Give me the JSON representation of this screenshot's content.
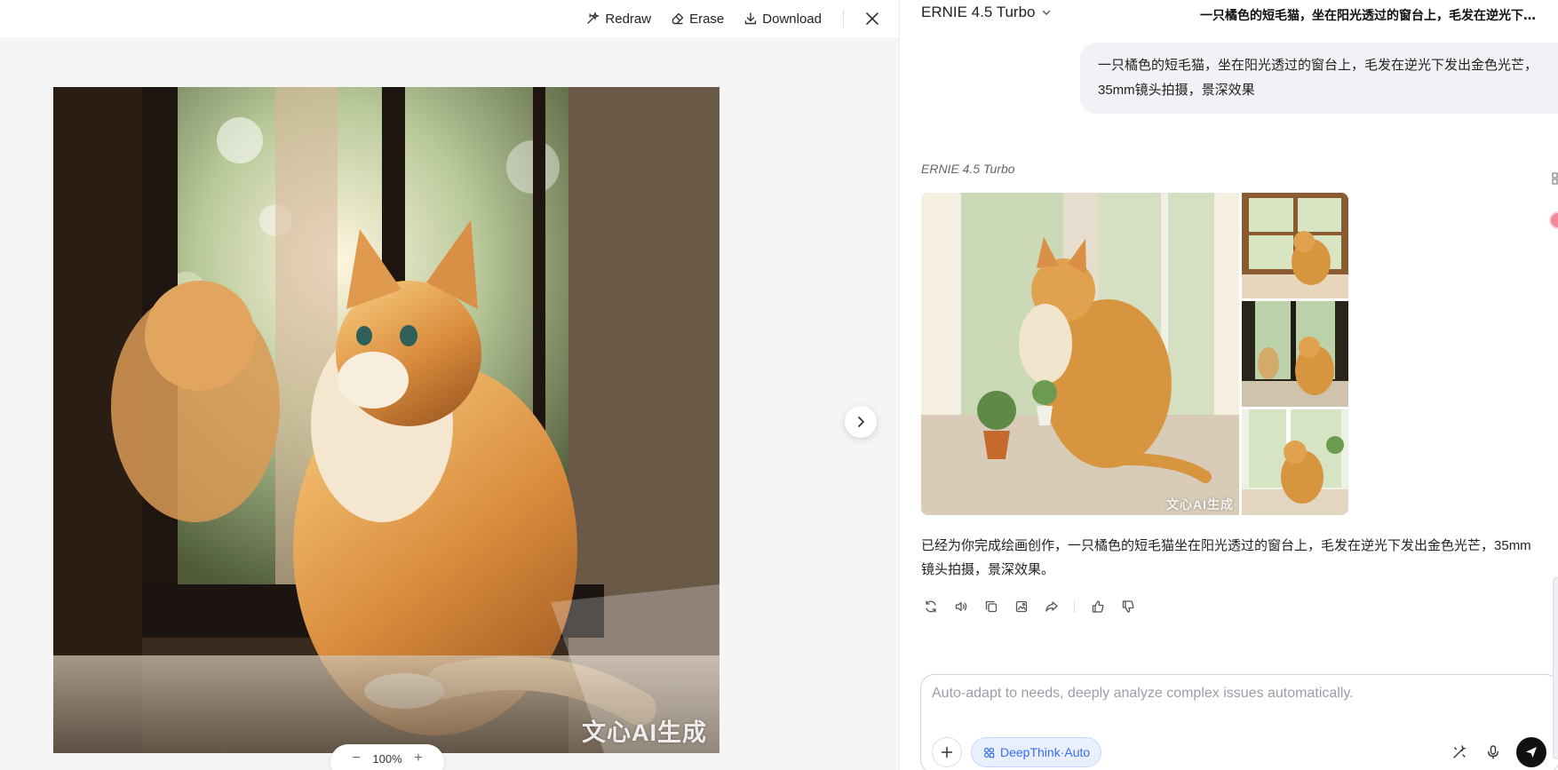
{
  "preview": {
    "toolbar": {
      "redraw_label": "Redraw",
      "erase_label": "Erase",
      "download_label": "Download"
    },
    "watermark": "文心AI生成",
    "zoom": {
      "value": "100%",
      "minus": "−",
      "plus": "+"
    }
  },
  "chat": {
    "model_name": "ERNIE 4.5 Turbo",
    "title": "一只橘色的短毛猫，坐在阳光透过的窗台上，毛发在逆光下发...",
    "user_message": "一只橘色的短毛猫，坐在阳光透过的窗台上，毛发在逆光下发出金色光芒，35mm镜头拍摄，景深效果",
    "response_model": "ERNIE 4.5 Turbo",
    "image_watermark": "文心AI生成",
    "response_text": "已经为你完成绘画创作，一只橘色的短毛猫坐在阳光透过的窗台上，毛发在逆光下发出金色光芒，35mm镜头拍摄，景深效果。"
  },
  "composer": {
    "placeholder": "Auto-adapt to needs, deeply analyze complex issues automatically.",
    "deepthink_label": "DeepThink·Auto"
  },
  "icons": {
    "redraw": "redraw-icon",
    "erase": "eraser-icon",
    "download": "download-icon",
    "close": "close-icon",
    "next": "chevron-right-icon",
    "regenerate": "refresh-icon",
    "speaker": "speaker-icon",
    "copy": "copy-icon",
    "image": "image-icon",
    "share": "share-icon",
    "like": "thumbs-up-icon",
    "dislike": "thumbs-down-icon",
    "plus": "plus-icon",
    "deepthink": "deepthink-icon",
    "tools": "magic-wand-icon",
    "mic": "microphone-icon",
    "send": "send-icon"
  },
  "colors": {
    "accent": "#3b6cf0",
    "bubble": "#f1f2f5",
    "send_button": "#111111"
  }
}
